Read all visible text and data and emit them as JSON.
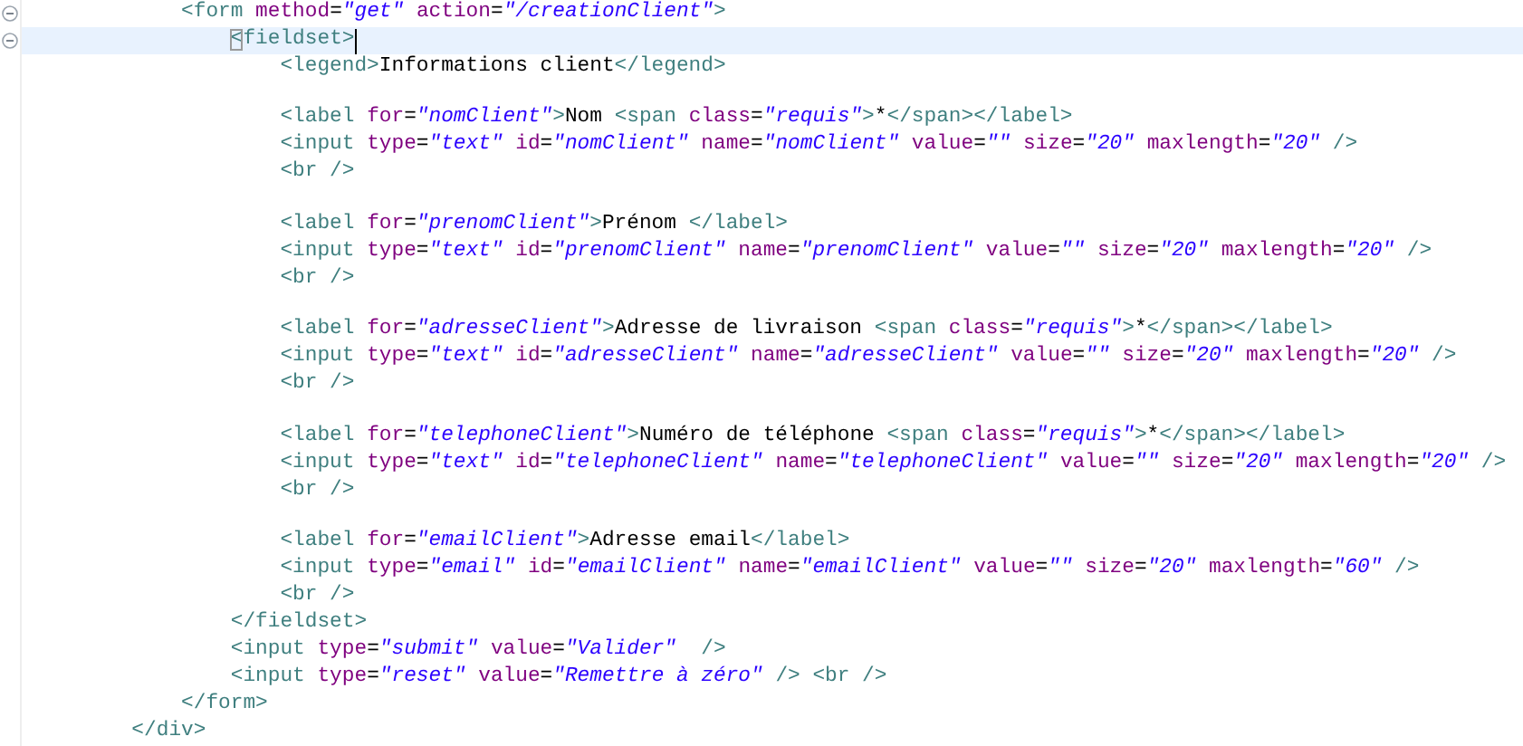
{
  "editor": {
    "lines": [
      {
        "fold": true,
        "selected": false,
        "tokens": [
          {
            "kind": "tag",
            "text": "            <form"
          },
          {
            "kind": "attr",
            "text": " method"
          },
          {
            "kind": "text",
            "text": "="
          },
          {
            "kind": "string",
            "text": "\"get\""
          },
          {
            "kind": "attr",
            "text": " action"
          },
          {
            "kind": "text",
            "text": "="
          },
          {
            "kind": "string",
            "text": "\"/creationClient\""
          },
          {
            "kind": "tag",
            "text": ">"
          }
        ]
      },
      {
        "fold": true,
        "selected": true,
        "tokens": [
          {
            "kind": "tag",
            "text": "                <fieldset>"
          }
        ]
      },
      {
        "fold": false,
        "selected": false,
        "tokens": [
          {
            "kind": "tag",
            "text": "                    <legend>"
          },
          {
            "kind": "text",
            "text": "Informations client"
          },
          {
            "kind": "tag",
            "text": "</legend>"
          }
        ]
      },
      {
        "fold": false,
        "selected": false
      },
      {
        "fold": false,
        "selected": false,
        "tokens": [
          {
            "kind": "tag",
            "text": "                    <label"
          },
          {
            "kind": "attr",
            "text": " for"
          },
          {
            "kind": "text",
            "text": "="
          },
          {
            "kind": "string",
            "text": "\"nomClient\""
          },
          {
            "kind": "tag",
            "text": ">"
          },
          {
            "kind": "text",
            "text": "Nom "
          },
          {
            "kind": "tag",
            "text": "<span"
          },
          {
            "kind": "attr",
            "text": " class"
          },
          {
            "kind": "text",
            "text": "="
          },
          {
            "kind": "string",
            "text": "\"requis\""
          },
          {
            "kind": "tag",
            "text": ">"
          },
          {
            "kind": "text",
            "text": "*"
          },
          {
            "kind": "tag",
            "text": "</span></label>"
          }
        ]
      },
      {
        "fold": false,
        "selected": false,
        "tokens": [
          {
            "kind": "tag",
            "text": "                    <input"
          },
          {
            "kind": "attr",
            "text": " type"
          },
          {
            "kind": "text",
            "text": "="
          },
          {
            "kind": "string",
            "text": "\"text\""
          },
          {
            "kind": "attr",
            "text": " id"
          },
          {
            "kind": "text",
            "text": "="
          },
          {
            "kind": "string",
            "text": "\"nomClient\""
          },
          {
            "kind": "attr",
            "text": " name"
          },
          {
            "kind": "text",
            "text": "="
          },
          {
            "kind": "string",
            "text": "\"nomClient\""
          },
          {
            "kind": "attr",
            "text": " value"
          },
          {
            "kind": "text",
            "text": "="
          },
          {
            "kind": "string",
            "text": "\"\""
          },
          {
            "kind": "attr",
            "text": " size"
          },
          {
            "kind": "text",
            "text": "="
          },
          {
            "kind": "string",
            "text": "\"20\""
          },
          {
            "kind": "attr",
            "text": " maxlength"
          },
          {
            "kind": "text",
            "text": "="
          },
          {
            "kind": "string",
            "text": "\"20\""
          },
          {
            "kind": "tag",
            "text": " />"
          }
        ]
      },
      {
        "fold": false,
        "selected": false,
        "tokens": [
          {
            "kind": "tag",
            "text": "                    <br />"
          }
        ]
      },
      {
        "fold": false,
        "selected": false
      },
      {
        "fold": false,
        "selected": false,
        "tokens": [
          {
            "kind": "tag",
            "text": "                    <label"
          },
          {
            "kind": "attr",
            "text": " for"
          },
          {
            "kind": "text",
            "text": "="
          },
          {
            "kind": "string",
            "text": "\"prenomClient\""
          },
          {
            "kind": "tag",
            "text": ">"
          },
          {
            "kind": "text",
            "text": "Prénom "
          },
          {
            "kind": "tag",
            "text": "</label>"
          }
        ]
      },
      {
        "fold": false,
        "selected": false,
        "tokens": [
          {
            "kind": "tag",
            "text": "                    <input"
          },
          {
            "kind": "attr",
            "text": " type"
          },
          {
            "kind": "text",
            "text": "="
          },
          {
            "kind": "string",
            "text": "\"text\""
          },
          {
            "kind": "attr",
            "text": " id"
          },
          {
            "kind": "text",
            "text": "="
          },
          {
            "kind": "string",
            "text": "\"prenomClient\""
          },
          {
            "kind": "attr",
            "text": " name"
          },
          {
            "kind": "text",
            "text": "="
          },
          {
            "kind": "string",
            "text": "\"prenomClient\""
          },
          {
            "kind": "attr",
            "text": " value"
          },
          {
            "kind": "text",
            "text": "="
          },
          {
            "kind": "string",
            "text": "\"\""
          },
          {
            "kind": "attr",
            "text": " size"
          },
          {
            "kind": "text",
            "text": "="
          },
          {
            "kind": "string",
            "text": "\"20\""
          },
          {
            "kind": "attr",
            "text": " maxlength"
          },
          {
            "kind": "text",
            "text": "="
          },
          {
            "kind": "string",
            "text": "\"20\""
          },
          {
            "kind": "tag",
            "text": " />"
          }
        ]
      },
      {
        "fold": false,
        "selected": false,
        "tokens": [
          {
            "kind": "tag",
            "text": "                    <br />"
          }
        ]
      },
      {
        "fold": false,
        "selected": false
      },
      {
        "fold": false,
        "selected": false,
        "tokens": [
          {
            "kind": "tag",
            "text": "                    <label"
          },
          {
            "kind": "attr",
            "text": " for"
          },
          {
            "kind": "text",
            "text": "="
          },
          {
            "kind": "string",
            "text": "\"adresseClient\""
          },
          {
            "kind": "tag",
            "text": ">"
          },
          {
            "kind": "text",
            "text": "Adresse de livraison "
          },
          {
            "kind": "tag",
            "text": "<span"
          },
          {
            "kind": "attr",
            "text": " class"
          },
          {
            "kind": "text",
            "text": "="
          },
          {
            "kind": "string",
            "text": "\"requis\""
          },
          {
            "kind": "tag",
            "text": ">"
          },
          {
            "kind": "text",
            "text": "*"
          },
          {
            "kind": "tag",
            "text": "</span></label>"
          }
        ]
      },
      {
        "fold": false,
        "selected": false,
        "tokens": [
          {
            "kind": "tag",
            "text": "                    <input"
          },
          {
            "kind": "attr",
            "text": " type"
          },
          {
            "kind": "text",
            "text": "="
          },
          {
            "kind": "string",
            "text": "\"text\""
          },
          {
            "kind": "attr",
            "text": " id"
          },
          {
            "kind": "text",
            "text": "="
          },
          {
            "kind": "string",
            "text": "\"adresseClient\""
          },
          {
            "kind": "attr",
            "text": " name"
          },
          {
            "kind": "text",
            "text": "="
          },
          {
            "kind": "string",
            "text": "\"adresseClient\""
          },
          {
            "kind": "attr",
            "text": " value"
          },
          {
            "kind": "text",
            "text": "="
          },
          {
            "kind": "string",
            "text": "\"\""
          },
          {
            "kind": "attr",
            "text": " size"
          },
          {
            "kind": "text",
            "text": "="
          },
          {
            "kind": "string",
            "text": "\"20\""
          },
          {
            "kind": "attr",
            "text": " maxlength"
          },
          {
            "kind": "text",
            "text": "="
          },
          {
            "kind": "string",
            "text": "\"20\""
          },
          {
            "kind": "tag",
            "text": " />"
          }
        ]
      },
      {
        "fold": false,
        "selected": false,
        "tokens": [
          {
            "kind": "tag",
            "text": "                    <br />"
          }
        ]
      },
      {
        "fold": false,
        "selected": false
      },
      {
        "fold": false,
        "selected": false,
        "tokens": [
          {
            "kind": "tag",
            "text": "                    <label"
          },
          {
            "kind": "attr",
            "text": " for"
          },
          {
            "kind": "text",
            "text": "="
          },
          {
            "kind": "string",
            "text": "\"telephoneClient\""
          },
          {
            "kind": "tag",
            "text": ">"
          },
          {
            "kind": "text",
            "text": "Numéro de téléphone "
          },
          {
            "kind": "tag",
            "text": "<span"
          },
          {
            "kind": "attr",
            "text": " class"
          },
          {
            "kind": "text",
            "text": "="
          },
          {
            "kind": "string",
            "text": "\"requis\""
          },
          {
            "kind": "tag",
            "text": ">"
          },
          {
            "kind": "text",
            "text": "*"
          },
          {
            "kind": "tag",
            "text": "</span></label>"
          }
        ]
      },
      {
        "fold": false,
        "selected": false,
        "tokens": [
          {
            "kind": "tag",
            "text": "                    <input"
          },
          {
            "kind": "attr",
            "text": " type"
          },
          {
            "kind": "text",
            "text": "="
          },
          {
            "kind": "string",
            "text": "\"text\""
          },
          {
            "kind": "attr",
            "text": " id"
          },
          {
            "kind": "text",
            "text": "="
          },
          {
            "kind": "string",
            "text": "\"telephoneClient\""
          },
          {
            "kind": "attr",
            "text": " name"
          },
          {
            "kind": "text",
            "text": "="
          },
          {
            "kind": "string",
            "text": "\"telephoneClient\""
          },
          {
            "kind": "attr",
            "text": " value"
          },
          {
            "kind": "text",
            "text": "="
          },
          {
            "kind": "string",
            "text": "\"\""
          },
          {
            "kind": "attr",
            "text": " size"
          },
          {
            "kind": "text",
            "text": "="
          },
          {
            "kind": "string",
            "text": "\"20\""
          },
          {
            "kind": "attr",
            "text": " maxlength"
          },
          {
            "kind": "text",
            "text": "="
          },
          {
            "kind": "string",
            "text": "\"20\""
          },
          {
            "kind": "tag",
            "text": " />"
          }
        ]
      },
      {
        "fold": false,
        "selected": false,
        "tokens": [
          {
            "kind": "tag",
            "text": "                    <br />"
          }
        ]
      },
      {
        "fold": false,
        "selected": false
      },
      {
        "fold": false,
        "selected": false,
        "tokens": [
          {
            "kind": "tag",
            "text": "                    <label"
          },
          {
            "kind": "attr",
            "text": " for"
          },
          {
            "kind": "text",
            "text": "="
          },
          {
            "kind": "string",
            "text": "\"emailClient\""
          },
          {
            "kind": "tag",
            "text": ">"
          },
          {
            "kind": "text",
            "text": "Adresse email"
          },
          {
            "kind": "tag",
            "text": "</label>"
          }
        ]
      },
      {
        "fold": false,
        "selected": false,
        "tokens": [
          {
            "kind": "tag",
            "text": "                    <input"
          },
          {
            "kind": "attr",
            "text": " type"
          },
          {
            "kind": "text",
            "text": "="
          },
          {
            "kind": "string",
            "text": "\"email\""
          },
          {
            "kind": "attr",
            "text": " id"
          },
          {
            "kind": "text",
            "text": "="
          },
          {
            "kind": "string",
            "text": "\"emailClient\""
          },
          {
            "kind": "attr",
            "text": " name"
          },
          {
            "kind": "text",
            "text": "="
          },
          {
            "kind": "string",
            "text": "\"emailClient\""
          },
          {
            "kind": "attr",
            "text": " value"
          },
          {
            "kind": "text",
            "text": "="
          },
          {
            "kind": "string",
            "text": "\"\""
          },
          {
            "kind": "attr",
            "text": " size"
          },
          {
            "kind": "text",
            "text": "="
          },
          {
            "kind": "string",
            "text": "\"20\""
          },
          {
            "kind": "attr",
            "text": " maxlength"
          },
          {
            "kind": "text",
            "text": "="
          },
          {
            "kind": "string",
            "text": "\"60\""
          },
          {
            "kind": "tag",
            "text": " />"
          }
        ]
      },
      {
        "fold": false,
        "selected": false,
        "tokens": [
          {
            "kind": "tag",
            "text": "                    <br />"
          }
        ]
      },
      {
        "fold": false,
        "selected": false,
        "tokens": [
          {
            "kind": "tag",
            "text": "                </fieldset>"
          }
        ]
      },
      {
        "fold": false,
        "selected": false,
        "tokens": [
          {
            "kind": "tag",
            "text": "                <input"
          },
          {
            "kind": "attr",
            "text": " type"
          },
          {
            "kind": "text",
            "text": "="
          },
          {
            "kind": "string",
            "text": "\"submit\""
          },
          {
            "kind": "attr",
            "text": " value"
          },
          {
            "kind": "text",
            "text": "="
          },
          {
            "kind": "string",
            "text": "\"Valider\""
          },
          {
            "kind": "tag",
            "text": "  />"
          }
        ]
      },
      {
        "fold": false,
        "selected": false,
        "tokens": [
          {
            "kind": "tag",
            "text": "                <input"
          },
          {
            "kind": "attr",
            "text": " type"
          },
          {
            "kind": "text",
            "text": "="
          },
          {
            "kind": "string",
            "text": "\"reset\""
          },
          {
            "kind": "attr",
            "text": " value"
          },
          {
            "kind": "text",
            "text": "="
          },
          {
            "kind": "string",
            "text": "\"Remettre à zéro\""
          },
          {
            "kind": "tag",
            "text": " /> <br />"
          }
        ]
      },
      {
        "fold": false,
        "selected": false,
        "tokens": [
          {
            "kind": "tag",
            "text": "            </form>"
          }
        ]
      },
      {
        "fold": false,
        "selected": false,
        "tokens": [
          {
            "kind": "tag",
            "text": "        </div>"
          }
        ]
      }
    ]
  }
}
